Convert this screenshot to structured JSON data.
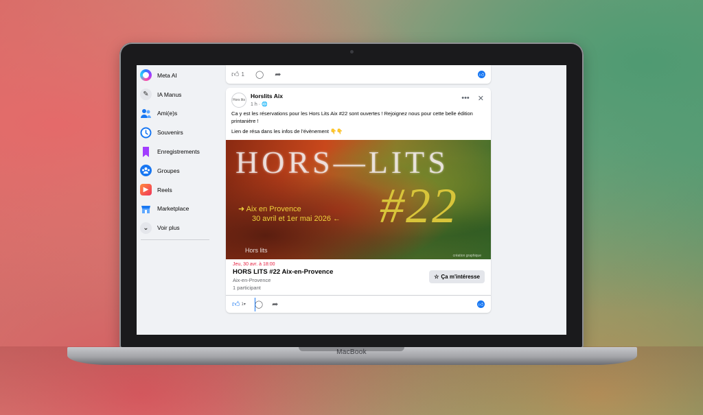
{
  "device": {
    "brand": "MacBook"
  },
  "sidebar": {
    "items": [
      {
        "label": "Meta AI",
        "icon": "meta-ai-icon",
        "color": "#8a3ffc"
      },
      {
        "label": "IA Manus",
        "icon": "manus-icon",
        "color": "#e4e6eb"
      },
      {
        "label": "Ami(e)s",
        "icon": "friends-icon",
        "color": "#1877f2"
      },
      {
        "label": "Souvenirs",
        "icon": "memories-clock-icon",
        "color": "#1877f2"
      },
      {
        "label": "Enregistrements",
        "icon": "bookmark-icon",
        "color": "#8b3dff"
      },
      {
        "label": "Groupes",
        "icon": "groups-icon",
        "color": "#1877f2"
      },
      {
        "label": "Reels",
        "icon": "reels-icon",
        "color": "#f0433a"
      },
      {
        "label": "Marketplace",
        "icon": "marketplace-icon",
        "color": "#1877f2"
      },
      {
        "label": "Voir plus",
        "icon": "chevron-down-icon",
        "color": "#e4e6eb"
      }
    ]
  },
  "top_post": {
    "like_count": "1"
  },
  "post": {
    "author": "Horslits Aix",
    "avatar_text": "Hors lits",
    "meta": "1 h · 🌐",
    "text_line_1": "Ca y est les réservations pour les Hors Lits Aix #22 sont ouvertes ! Rejoignez nous pour cette belle édition printanière !",
    "text_line_2": "Lien de résa dans les infos de l'évènement 👇👇",
    "poster": {
      "title": "HORS—LITS",
      "number": "#22",
      "city": "➜ Aix en Provence",
      "dates": "30 avril et 1er mai 2026 ←",
      "logo": "Hors lits",
      "credit": "création graphique"
    },
    "event": {
      "date": "Jeu, 30 avr. à 18:00",
      "title": "HORS LITS #22 Aix-en-Provence",
      "place": "Aix-en-Provence",
      "participants": "1 participant",
      "interest_label": "Ça m'intéresse"
    }
  }
}
